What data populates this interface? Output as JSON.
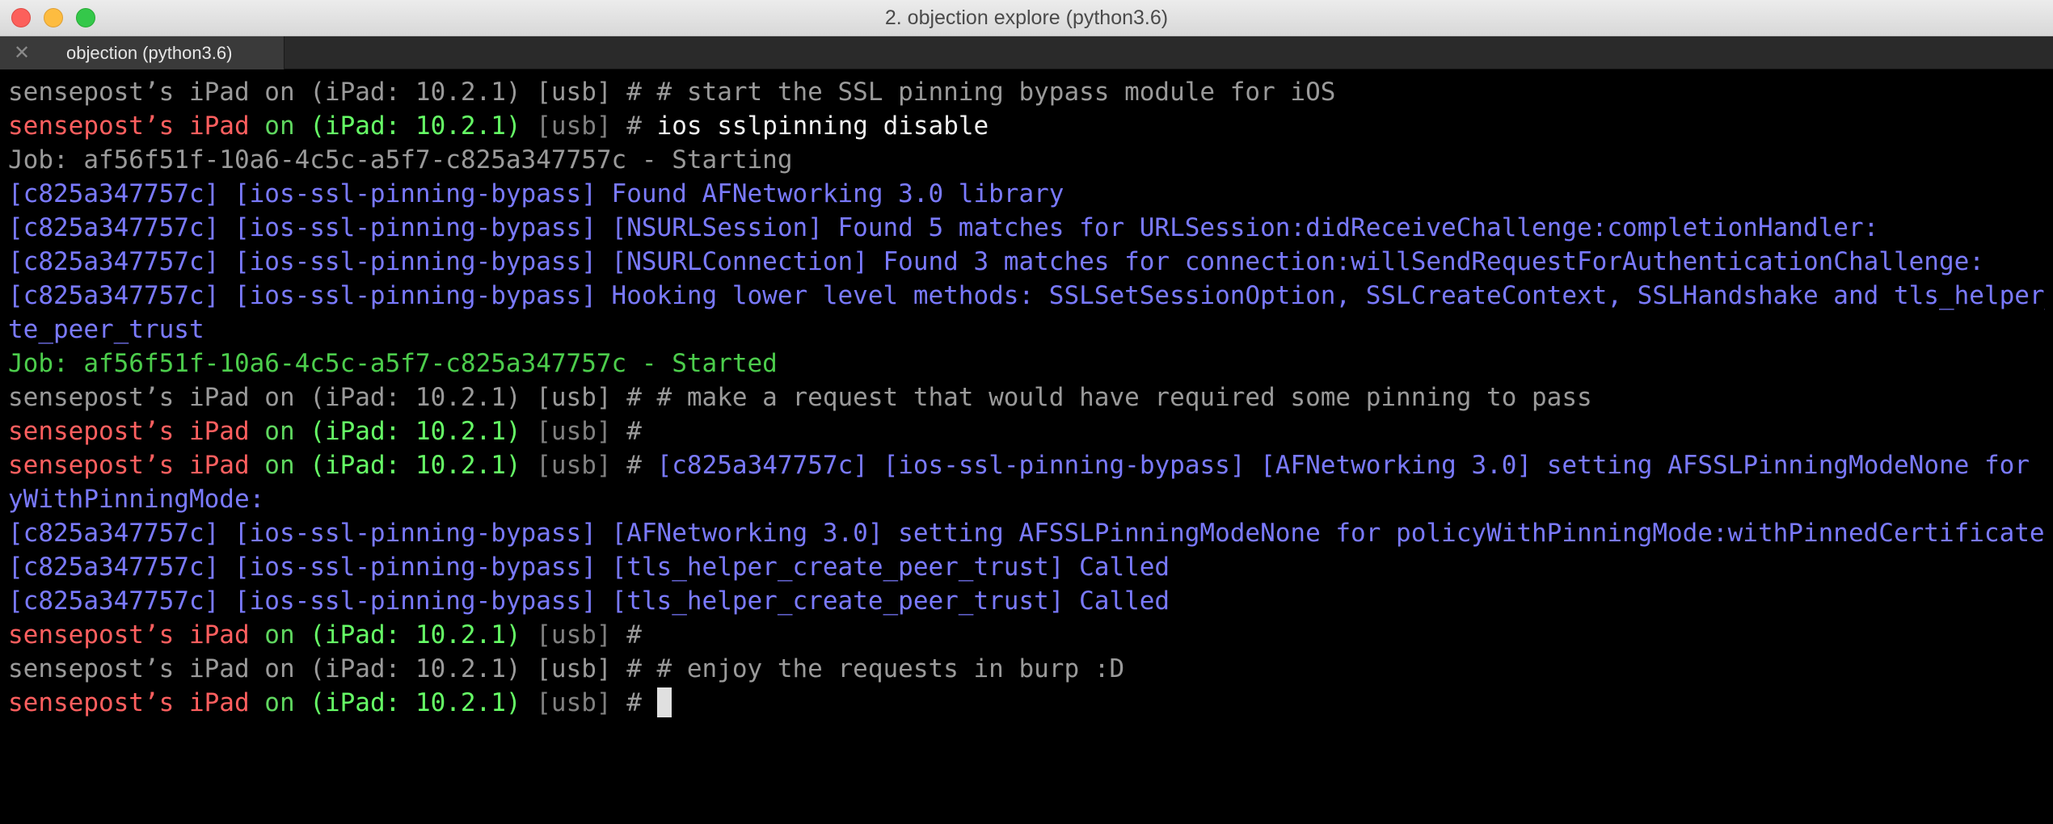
{
  "window": {
    "title": "2. objection explore (python3.6)"
  },
  "tabs": [
    {
      "label": "objection (python3.6)",
      "close_glyph": "✕"
    }
  ],
  "prompt": {
    "user": "sensepost’s iPad",
    "on": "on",
    "host": "(iPad: 10.2.1)",
    "usb": "[usb]",
    "hash": "#"
  },
  "terminal": {
    "l1": "sensepost’s iPad on (iPad: 10.2.1) [usb] # # start the SSL pinning bypass module for iOS",
    "l2_cmd": "ios sslpinning disable",
    "l3": "Job: af56f51f-10a6-4c5c-a5f7-c825a347757c - Starting",
    "l4": "[c825a347757c] [ios-ssl-pinning-bypass] Found AFNetworking 3.0 library",
    "l5": "[c825a347757c] [ios-ssl-pinning-bypass] [NSURLSession] Found 5 matches for URLSession:didReceiveChallenge:completionHandler:",
    "l6": "[c825a347757c] [ios-ssl-pinning-bypass] [NSURLConnection] Found 3 matches for connection:willSendRequestForAuthenticationChallenge:",
    "l7": "[c825a347757c] [ios-ssl-pinning-bypass] Hooking lower level methods: SSLSetSessionOption, SSLCreateContext, SSLHandshake and tls_helper_crea",
    "l8": "te_peer_trust",
    "l9": "Job: af56f51f-10a6-4c5c-a5f7-c825a347757c - Started",
    "l10": "sensepost’s iPad on (iPad: 10.2.1) [usb] # # make a request that would have required some pinning to pass",
    "l12_out": "[c825a347757c] [ios-ssl-pinning-bypass] [AFNetworking 3.0] setting AFSSLPinningModeNone for polic",
    "l13": "yWithPinningMode:",
    "l14": "[c825a347757c] [ios-ssl-pinning-bypass] [AFNetworking 3.0] setting AFSSLPinningModeNone for policyWithPinningMode:withPinnedCertificates:",
    "l15": "[c825a347757c] [ios-ssl-pinning-bypass] [tls_helper_create_peer_trust] Called",
    "l16": "[c825a347757c] [ios-ssl-pinning-bypass] [tls_helper_create_peer_trust] Called",
    "l18": "sensepost’s iPad on (iPad: 10.2.1) [usb] # # enjoy the requests in burp :D"
  },
  "colors": {
    "user": "#ff5f5f",
    "host": "#66ff66",
    "output_blue": "#7a7aff",
    "job_green": "#4ccd4c",
    "comment_gray": "#9a9a9a"
  }
}
